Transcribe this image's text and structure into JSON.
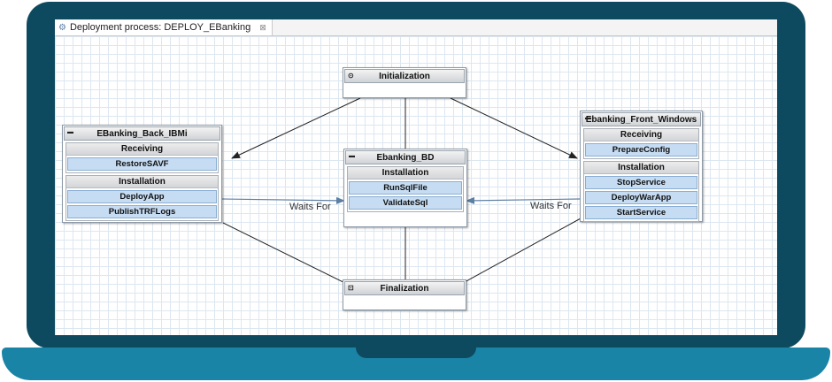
{
  "tab": {
    "title": "Deployment process: DEPLOY_EBanking",
    "icon": "gear-icon",
    "close": "⊠"
  },
  "nodes": {
    "initialization": {
      "title": "Initialization",
      "icon": "play-circle-icon"
    },
    "back": {
      "title": "EBanking_Back_IBMi",
      "icon": "terminal-icon",
      "groups": [
        {
          "title": "Receiving",
          "steps": [
            "RestoreSAVF"
          ]
        },
        {
          "title": "Installation",
          "steps": [
            "DeployApp",
            "PublishTRFLogs"
          ]
        }
      ]
    },
    "bd": {
      "title": "Ebanking_BD",
      "icon": "terminal-icon",
      "groups": [
        {
          "title": "Installation",
          "steps": [
            "RunSqlFile",
            "ValidateSql"
          ]
        }
      ]
    },
    "front": {
      "title": "Ebanking_Front_Windows",
      "icon": "terminal-icon",
      "groups": [
        {
          "title": "Receiving",
          "steps": [
            "PrepareConfig"
          ]
        },
        {
          "title": "Installation",
          "steps": [
            "StopService",
            "DeployWarApp",
            "StartService"
          ]
        }
      ]
    },
    "finalization": {
      "title": "Finalization",
      "icon": "stop-circle-icon"
    }
  },
  "edge_labels": {
    "left": "Waits For",
    "right": "Waits For"
  },
  "colors": {
    "laptop_lid": "#0e4a5f",
    "laptop_base": "#1a84a6",
    "step_fill": "#c6dcf3",
    "edge_dark": "#222222",
    "edge_wait": "#5d7fa3"
  }
}
